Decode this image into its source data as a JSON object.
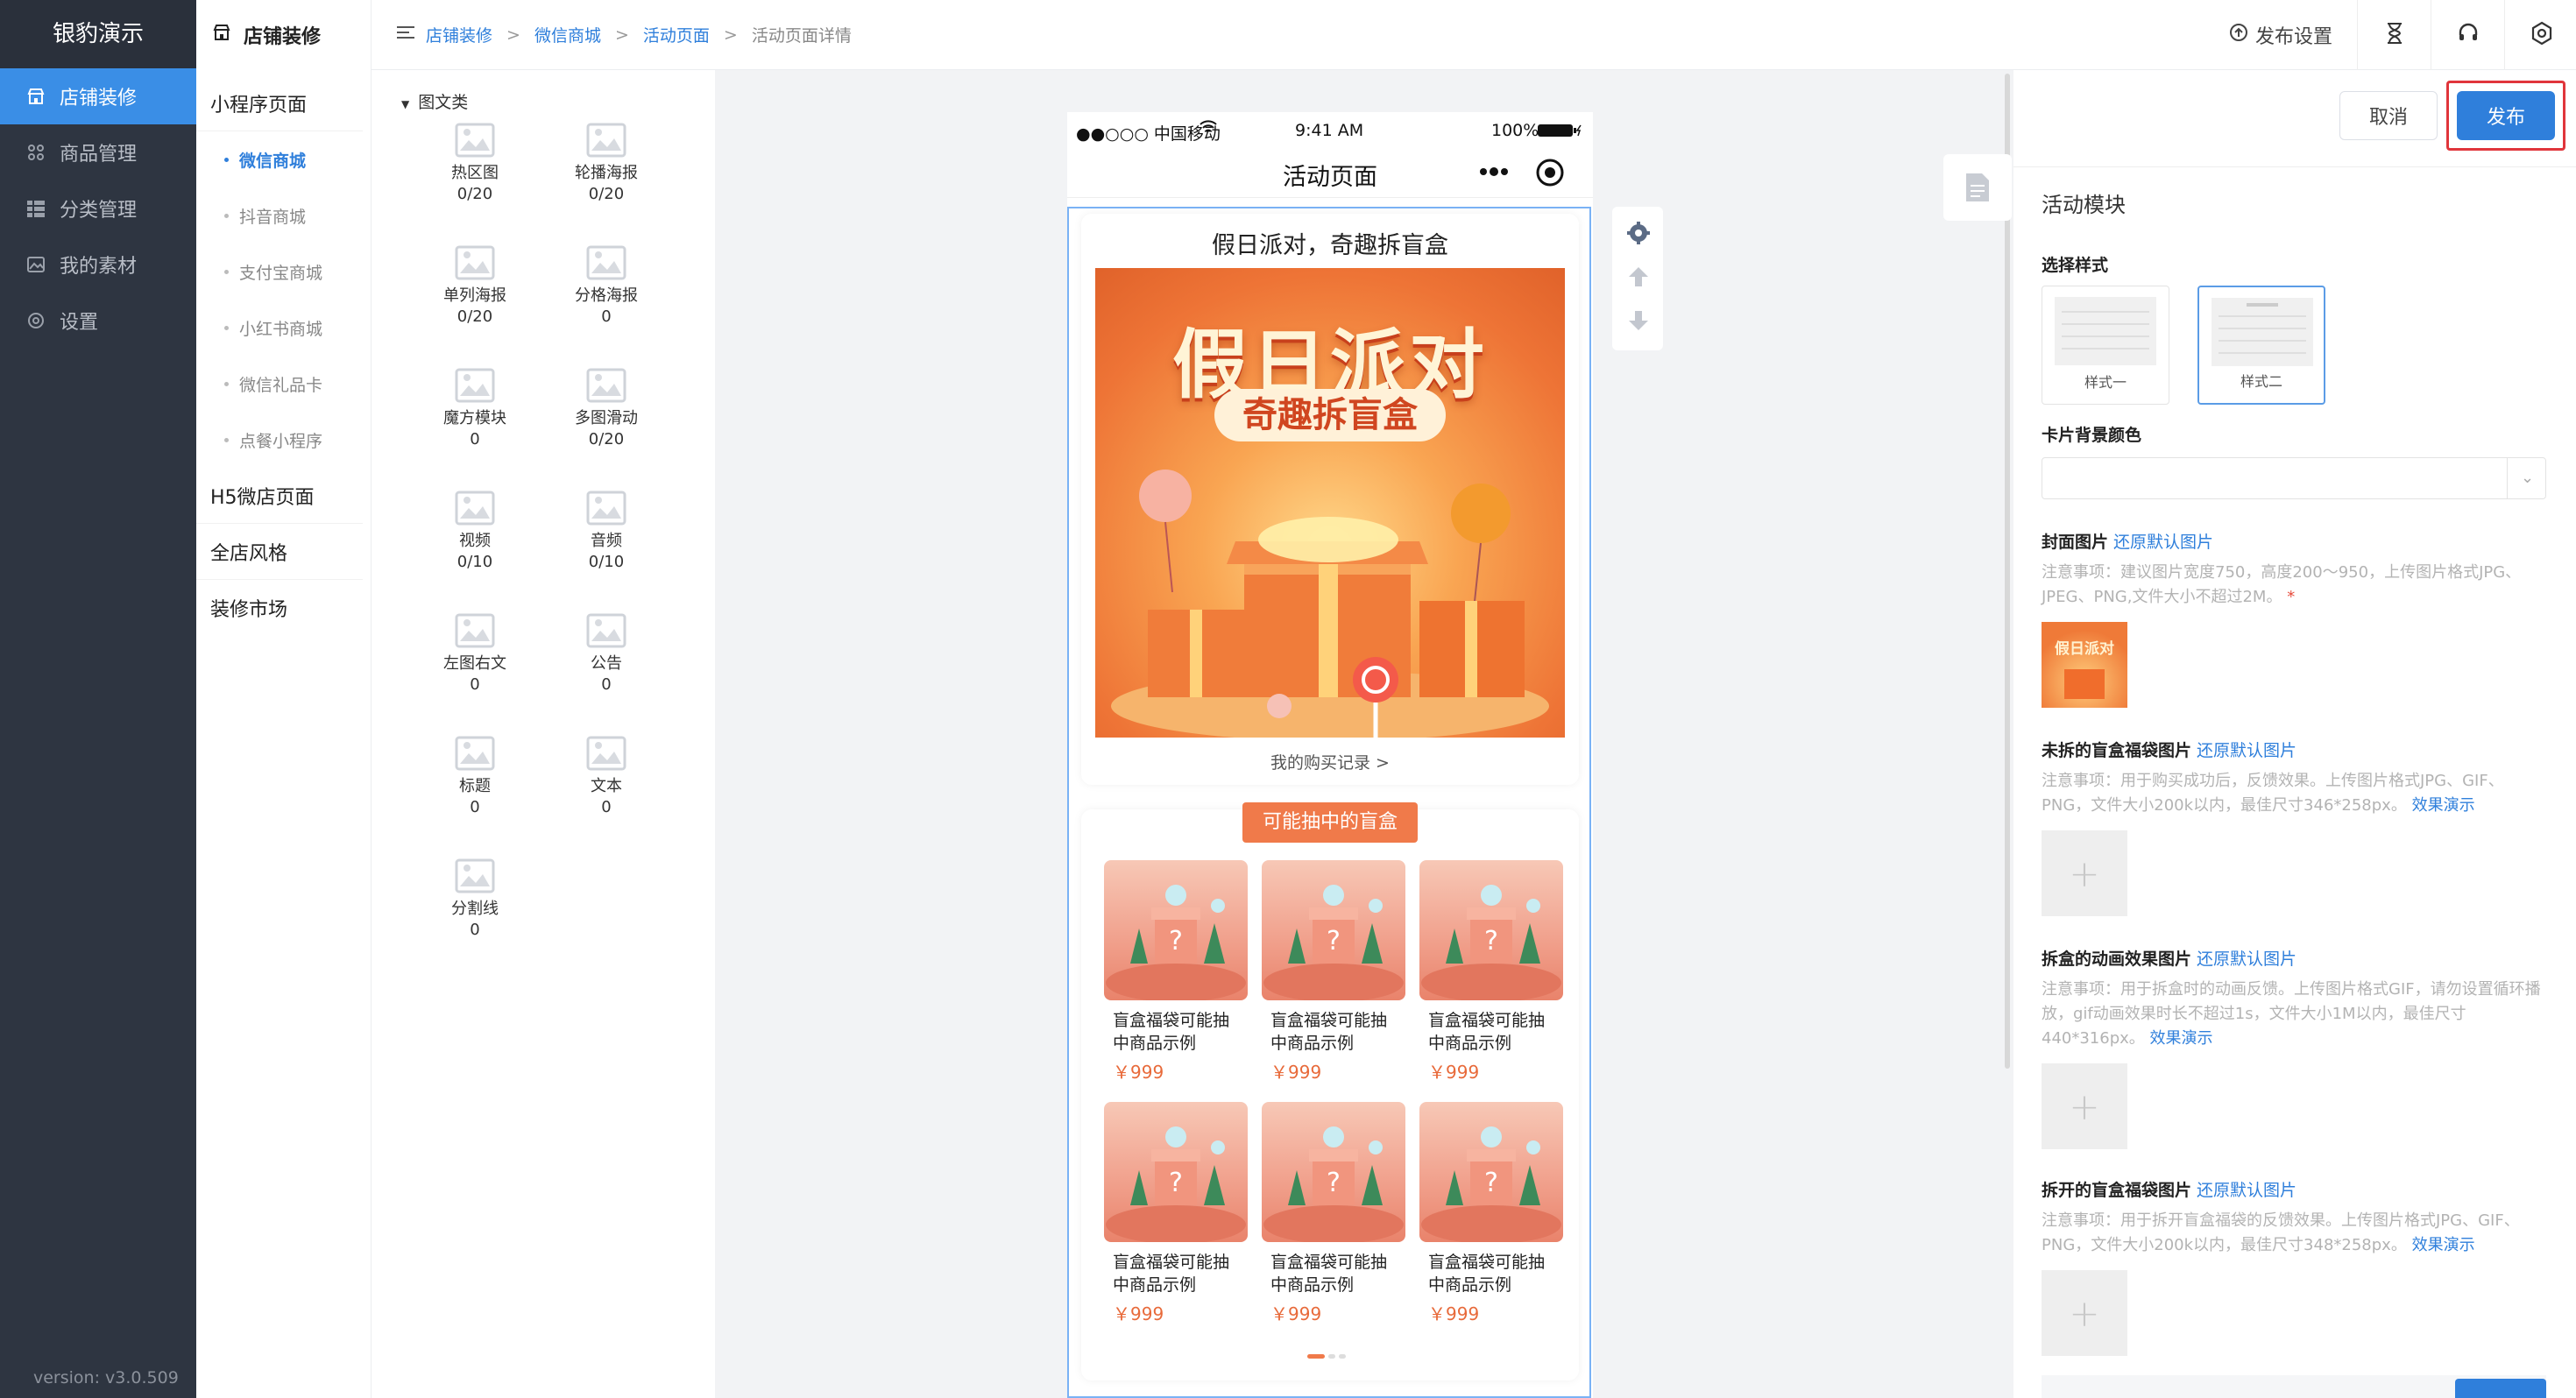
{
  "app": {
    "title": "银豹演示",
    "version": "version: v3.0.509"
  },
  "nav": {
    "items": [
      {
        "label": "店铺装修",
        "icon": "storefront-icon",
        "active": true
      },
      {
        "label": "商品管理",
        "icon": "grid-icon",
        "active": false
      },
      {
        "label": "分类管理",
        "icon": "list-icon",
        "active": false
      },
      {
        "label": "我的素材",
        "icon": "image-icon",
        "active": false
      },
      {
        "label": "设置",
        "icon": "gear-icon",
        "active": false
      }
    ]
  },
  "subnav": {
    "title": "店铺装修",
    "groups": [
      "小程序页面",
      "H5微店页面",
      "全店风格",
      "装修市场"
    ],
    "items": [
      "微信商城",
      "抖音商城",
      "支付宝商城",
      "小红书商城",
      "微信礼品卡",
      "点餐小程序"
    ],
    "active_item": "微信商城"
  },
  "breadcrumb": [
    "店铺装修",
    "微信商城",
    "活动页面",
    "活动页面详情"
  ],
  "header": {
    "publish_settings": "发布设置"
  },
  "widgets": {
    "category": "图文类",
    "items": [
      {
        "name": "热区图",
        "count": "0/20",
        "icon": "hotspot-image-icon"
      },
      {
        "name": "轮播海报",
        "count": "0/20",
        "icon": "carousel-icon"
      },
      {
        "name": "单列海报",
        "count": "0/20",
        "icon": "single-poster-icon"
      },
      {
        "name": "分格海报",
        "count": "0",
        "icon": "grid-poster-icon"
      },
      {
        "name": "魔方模块",
        "count": "0",
        "icon": "cube-icon"
      },
      {
        "name": "多图滑动",
        "count": "0/20",
        "icon": "multi-slide-icon"
      },
      {
        "name": "视频",
        "count": "0/10",
        "icon": "video-icon"
      },
      {
        "name": "音频",
        "count": "0/10",
        "icon": "audio-icon"
      },
      {
        "name": "左图右文",
        "count": "0",
        "icon": "image-text-icon"
      },
      {
        "name": "公告",
        "count": "0",
        "icon": "announcement-icon"
      },
      {
        "name": "标题",
        "count": "0",
        "icon": "title-icon"
      },
      {
        "name": "文本",
        "count": "0",
        "icon": "text-icon"
      },
      {
        "name": "分割线",
        "count": "0",
        "icon": "divider-icon"
      }
    ]
  },
  "phone": {
    "carrier": "●●○○○ 中国移动",
    "time": "9:41 AM",
    "battery": "100%",
    "page_title": "活动页面",
    "card_title": "假日派对，奇趣拆盲盒",
    "poster_main": "假日派对",
    "poster_sub": "奇趣拆盲盒",
    "purchase_link": "我的购买记录 >",
    "prize_title": "可能抽中的盲盒",
    "products": [
      {
        "name": "盲盒福袋可能抽中商品示例",
        "price": "￥999"
      },
      {
        "name": "盲盒福袋可能抽中商品示例",
        "price": "￥999"
      },
      {
        "name": "盲盒福袋可能抽中商品示例",
        "price": "￥999"
      },
      {
        "name": "盲盒福袋可能抽中商品示例",
        "price": "￥999"
      },
      {
        "name": "盲盒福袋可能抽中商品示例",
        "price": "￥999"
      },
      {
        "name": "盲盒福袋可能抽中商品示例",
        "price": "￥999"
      }
    ]
  },
  "right": {
    "cancel": "取消",
    "publish": "发布",
    "module_title": "活动模块",
    "style_label": "选择样式",
    "styles": [
      "样式一",
      "样式二"
    ],
    "selected_style": "样式二",
    "bg_color_label": "卡片背景颜色",
    "cover_label": "封面图片",
    "restore": "还原默认图片",
    "cover_note": "注意事项：建议图片宽度750，高度200～950，上传图片格式JPG、JPEG、PNG,文件大小不超过2M。",
    "cover_thumb_text": "假日派对",
    "unopened_label": "未拆的盲盒福袋图片",
    "unopened_note": "注意事项：用于购买成功后，反馈效果。上传图片格式JPG、GIF、PNG，文件大小200k以内，最佳尺寸346*258px。",
    "anim_label": "拆盒的动画效果图片",
    "anim_note": "注意事项：用于拆盒时的动画反馈。上传图片格式GIF，请勿设置循环播放，gif动画效果时长不超过1s，文件大小1M以内，最佳尺寸440*316px。",
    "opened_label": "拆开的盲盒福袋图片",
    "opened_note": "注意事项：用于拆开盲盒福袋的反馈效果。上传图片格式JPG、GIF、PNG，文件大小200k以内，最佳尺寸348*258px。",
    "demo_link": "效果演示",
    "plus": "+"
  },
  "colors": {
    "accent": "#2f7fdb",
    "nav_bg": "#2e3541",
    "active_bg": "#3a8ee6",
    "orange": "#f07a4a",
    "highlight_red": "#e0353b"
  }
}
